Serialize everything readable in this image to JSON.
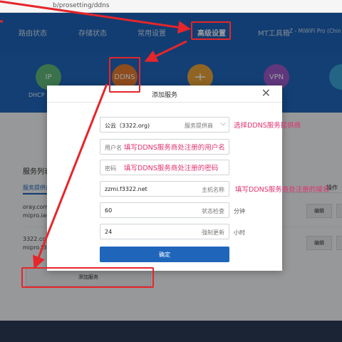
{
  "browser": {
    "url": "b/prosetting/ddns"
  },
  "nav": {
    "items": [
      {
        "label": "路由状态"
      },
      {
        "label": "存储状态"
      },
      {
        "label": "常用设置"
      },
      {
        "label": "高级设置"
      },
      {
        "label": "MT工具箱"
      }
    ],
    "device_name": "Z - MiWiFi Pro (Chin"
  },
  "services": [
    {
      "name": "IP",
      "label": "DHCP",
      "color": "#5fb87a"
    },
    {
      "name": "DDNS",
      "label": "",
      "color": "#e67a2e"
    },
    {
      "name": "",
      "label": "",
      "color": "#e8a33a"
    },
    {
      "name": "VPN",
      "label": "",
      "color": "#9b59c9"
    },
    {
      "name": "",
      "label": "",
      "color": "#3aa3d9"
    }
  ],
  "page": {
    "section_title": "服务列表",
    "subtab_label": "服务提供商",
    "col_operation": "操作",
    "rows": [
      {
        "line1": "oray.com",
        "line2": "mipro.iasi",
        "edit": "编辑"
      },
      {
        "line1": "3322.co",
        "line2": "mipro.f3",
        "edit": "编辑"
      }
    ],
    "add_service": "添加服务"
  },
  "modal": {
    "title": "添加服务",
    "provider": {
      "value": "公云（3322.org)",
      "label": "服务提供商"
    },
    "username": {
      "label": "用户名",
      "annotation": "填写DDNS服务商处注册的用户名"
    },
    "password": {
      "label": "密码",
      "annotation": "填写DDNS服务商处注册的密码"
    },
    "hostname": {
      "value": "zzmi.f3322.net",
      "label": "主机名称"
    },
    "check": {
      "value": "60",
      "label": "状态检查",
      "unit": "分钟"
    },
    "force": {
      "value": "24",
      "label": "强制更新",
      "unit": "小时"
    },
    "confirm": "确定",
    "annotations": {
      "provider": "选择DDNS服务提供商",
      "hostname": "填写DDNS服务商处注册的域名"
    }
  },
  "colors": {
    "accent": "#1f66bb",
    "annotation_red": "#e5262b",
    "annotation_pink": "#e0306e"
  }
}
